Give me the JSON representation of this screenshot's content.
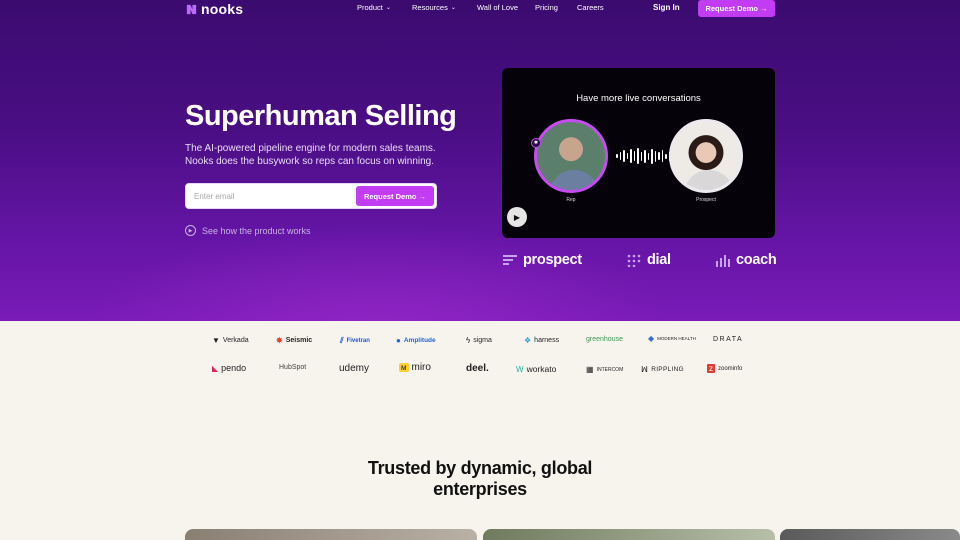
{
  "nav": {
    "logo": "nooks",
    "items": [
      {
        "label": "Product",
        "has_dropdown": true
      },
      {
        "label": "Resources",
        "has_dropdown": true
      },
      {
        "label": "Wall of Love",
        "has_dropdown": false
      },
      {
        "label": "Pricing",
        "has_dropdown": false
      },
      {
        "label": "Careers",
        "has_dropdown": false
      }
    ],
    "sign_in": "Sign In",
    "cta": "Request Demo →"
  },
  "hero": {
    "title": "Superhuman Selling",
    "subtitle_line1": "The AI-powered pipeline engine for modern sales teams.",
    "subtitle_line2": "Nooks does the busywork so reps can focus on winning.",
    "email_placeholder": "Enter email",
    "email_cta": "Request Demo →",
    "see_how": "See how the product works"
  },
  "video": {
    "title": "Have more live conversations",
    "rep_caption": "Rep",
    "prospect_caption": "Prospect"
  },
  "products": [
    "prospect",
    "dial",
    "coach"
  ],
  "customer_logos": {
    "row1": [
      "Verkada",
      "Seismic",
      "Fivetran",
      "Amplitude",
      "sigma",
      "harness",
      "greenhouse",
      "MODERN HEALTH",
      "DRATA"
    ],
    "row2": [
      "pendo",
      "HubSpot",
      "udemy",
      "miro",
      "deel.",
      "workato",
      "INTERCOM",
      "RIPPLING",
      "zoominfo"
    ]
  },
  "trusted": {
    "line1": "Trusted by dynamic, global",
    "line2": "enterprises"
  },
  "colors": {
    "brand_purple": "#4a0e84",
    "cta_magenta": "#c13cf3",
    "page_bg": "#f7f4ee"
  }
}
